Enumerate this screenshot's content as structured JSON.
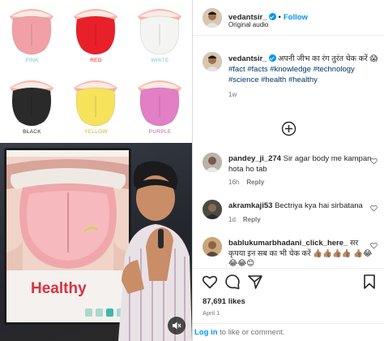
{
  "tongue_chart": {
    "items": [
      {
        "label": "PINK",
        "color": "#f2a0a8",
        "label_color": "#6cc6d8"
      },
      {
        "label": "RED",
        "color": "#e8202a",
        "label_color": "#e8202a"
      },
      {
        "label": "WHITE",
        "color": "#f4f4f2",
        "label_color": "#6cc6d8"
      },
      {
        "label": "BLACK",
        "color": "#2a2a2a",
        "label_color": "#2a2a2a"
      },
      {
        "label": "YELLOW",
        "color": "#f7e25c",
        "label_color": "#d9b21b"
      },
      {
        "label": "PURPLE",
        "color": "#e27fc5",
        "label_color": "#c262ad"
      }
    ]
  },
  "video": {
    "slide_caption": "Healthy",
    "caption_color": "#d83242"
  },
  "header": {
    "username": "vedantsir_",
    "follow_label": "Follow",
    "audio_label": "Original audio"
  },
  "caption": {
    "username": "vedantsir_",
    "text": "अपनी जीभ का रंग तुरंत चेक करें 😱",
    "hashtags": "#fact #facts #knowledge #technology #science #health #healthy",
    "time": "1w"
  },
  "comments": [
    {
      "username": "pandey_ji_274",
      "text": "Sir agar body me kampan hota ho tab",
      "time": "16h",
      "reply_label": "Reply"
    },
    {
      "username": "akramkaji53",
      "text": "Bectriya kya hai sirbatana",
      "time": "1d",
      "reply_label": "Reply"
    },
    {
      "username": "bablukumarbhadani_click_here_",
      "text": "सर कृपया इन सब का भी चेक करें 👍🏽👍🏽👍🏽👍🏽 👍🏽😂😂😂😊",
      "time": "",
      "reply_label": ""
    }
  ],
  "stats": {
    "likes": "87,691 likes",
    "date": "April 1"
  },
  "footer": {
    "login_label": "Log in",
    "rest": " to like or comment."
  },
  "colors": {
    "accent": "#0095f6",
    "hashtag": "#00376b",
    "muted": "#737373"
  }
}
